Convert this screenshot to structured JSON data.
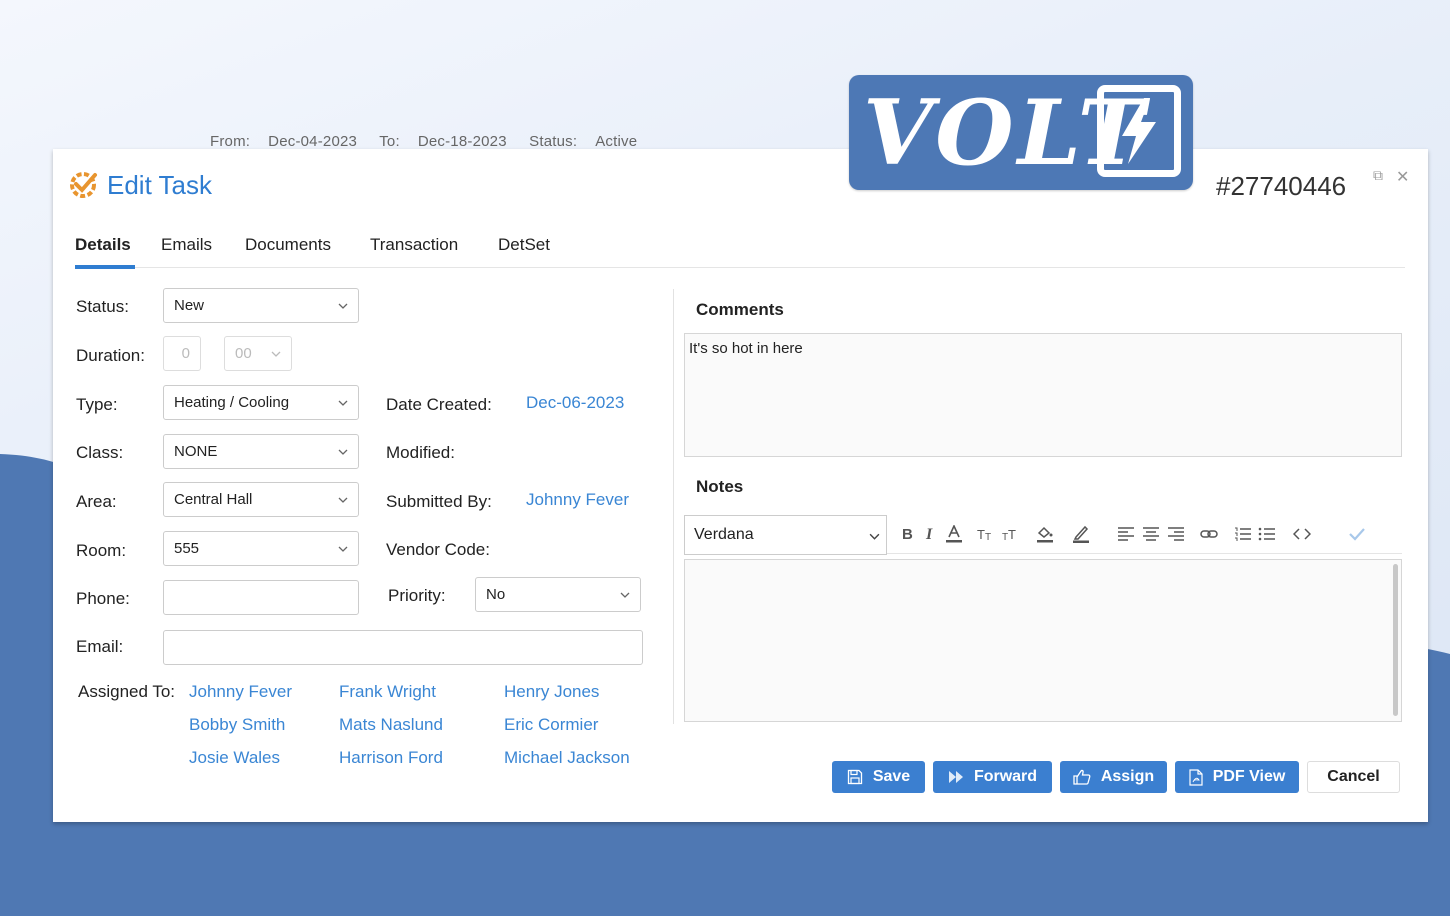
{
  "background_strip": [
    "From:",
    "Dec-04-2023",
    "To:",
    "Dec-18-2023",
    "Status:",
    "Active"
  ],
  "logo": {
    "text": "VOLT"
  },
  "header": {
    "title": "Edit Task",
    "task_id": "#27740446"
  },
  "tabs": [
    {
      "label": "Details",
      "active": true
    },
    {
      "label": "Emails"
    },
    {
      "label": "Documents"
    },
    {
      "label": "Transaction"
    },
    {
      "label": "DetSet"
    }
  ],
  "form": {
    "status_label": "Status:",
    "status_value": "New",
    "duration_label": "Duration:",
    "duration_value": "0",
    "duration_minutes": "00",
    "type_label": "Type:",
    "type_value": "Heating / Cooling",
    "class_label": "Class:",
    "class_value": "NONE",
    "area_label": "Area:",
    "area_value": "Central Hall",
    "room_label": "Room:",
    "room_value": "555",
    "phone_label": "Phone:",
    "phone_value": "",
    "email_label": "Email:",
    "email_value": "",
    "date_created_label": "Date Created:",
    "date_created_value": "Dec-06-2023",
    "modified_label": "Modified:",
    "submitted_by_label": "Submitted By:",
    "submitted_by_value": "Johnny Fever",
    "vendor_code_label": "Vendor Code:",
    "priority_label": "Priority:",
    "priority_value": "No",
    "assigned_to_label": "Assigned To:",
    "assignees": [
      "Johnny Fever",
      "Frank Wright",
      "Henry Jones",
      "Bobby Smith",
      "Mats Naslund",
      "Eric Cormier",
      "Josie Wales",
      "Harrison Ford",
      "Michael Jackson"
    ]
  },
  "comments": {
    "title": "Comments",
    "text": "It's so hot in here"
  },
  "notes": {
    "title": "Notes",
    "font": "Verdana",
    "text": ""
  },
  "buttons": {
    "save": "Save",
    "forward": "Forward",
    "assign": "Assign",
    "pdf_view": "PDF View",
    "cancel": "Cancel"
  },
  "colors": {
    "accent": "#3b7fd0",
    "link": "#3a86d4",
    "brand_blue": "#4d78b5",
    "icon_orange": "#e8952f"
  }
}
